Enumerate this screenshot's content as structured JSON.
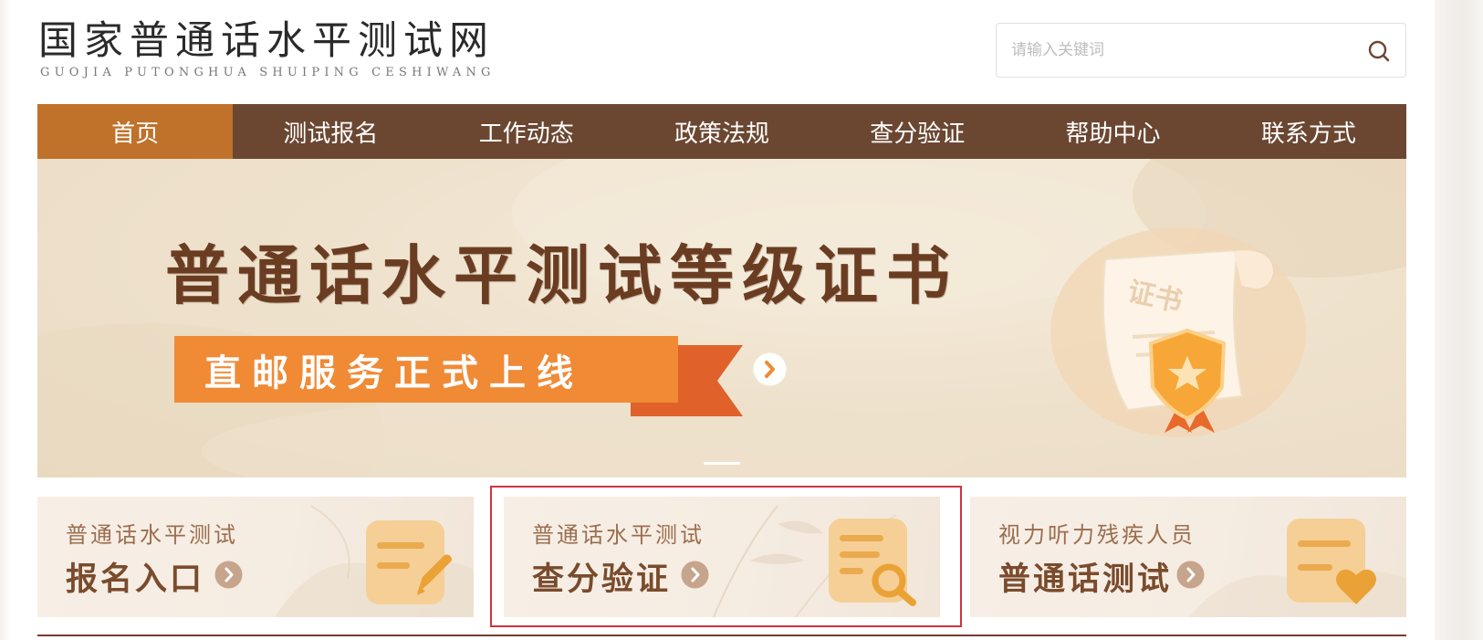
{
  "header": {
    "title": "国家普通话水平测试网",
    "subtitle": "GUOJIA PUTONGHUA SHUIPING CESHIWANG"
  },
  "search": {
    "placeholder": "请输入关键词",
    "icon": "search-icon"
  },
  "nav": {
    "items": [
      {
        "label": "首页",
        "active": true
      },
      {
        "label": "测试报名",
        "active": false
      },
      {
        "label": "工作动态",
        "active": false
      },
      {
        "label": "政策法规",
        "active": false
      },
      {
        "label": "查分验证",
        "active": false
      },
      {
        "label": "帮助中心",
        "active": false
      },
      {
        "label": "联系方式",
        "active": false
      }
    ]
  },
  "banner": {
    "title": "普通话水平测试等级证书",
    "button_label": "直邮服务正式上线",
    "cert_text": "证书",
    "slide_indicator_count": 1
  },
  "cards": [
    {
      "subtitle": "普通话水平测试",
      "title": "报名入口",
      "icon": "form-edit-icon"
    },
    {
      "subtitle": "普通话水平测试",
      "title": "查分验证",
      "icon": "document-search-icon",
      "highlighted": true
    },
    {
      "subtitle": "视力听力残疾人员",
      "title": "普通话测试",
      "icon": "document-heart-icon"
    }
  ],
  "colors": {
    "nav_bg": "#6b4732",
    "nav_active": "#c0712a",
    "banner_button": "#f08a35",
    "card_title": "#7a4b2c",
    "highlight_border": "#d0353f"
  }
}
